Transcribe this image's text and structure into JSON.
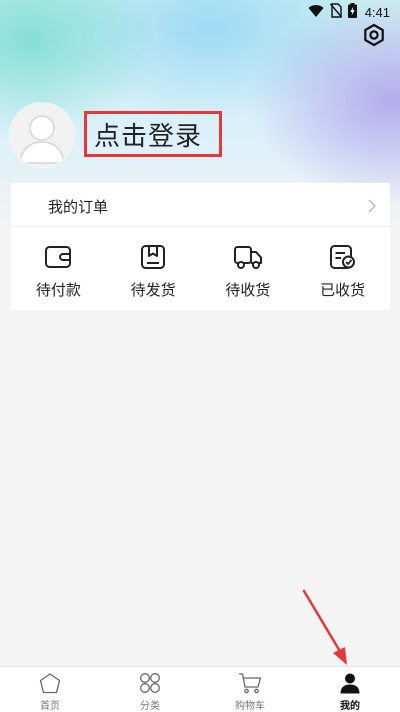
{
  "status_bar": {
    "time": "4:41",
    "icons": [
      "wifi-icon",
      "no-sim-icon",
      "battery-charging-icon"
    ]
  },
  "header": {
    "settings_icon": "settings-hex-icon",
    "avatar_icon": "default-avatar-icon",
    "login_label": "点击登录"
  },
  "orders": {
    "title": "我的订单",
    "items": [
      {
        "label": "待付款",
        "icon": "wallet-icon"
      },
      {
        "label": "待发货",
        "icon": "package-box-icon"
      },
      {
        "label": "待收货",
        "icon": "delivery-truck-icon"
      },
      {
        "label": "已收货",
        "icon": "received-check-icon"
      }
    ]
  },
  "bottom_nav": {
    "items": [
      {
        "label": "首页",
        "icon": "home-icon",
        "active": false
      },
      {
        "label": "分类",
        "icon": "category-grid-icon",
        "active": false
      },
      {
        "label": "购物车",
        "icon": "shopping-cart-icon",
        "active": false
      },
      {
        "label": "我的",
        "icon": "person-icon",
        "active": true
      }
    ]
  },
  "colors": {
    "highlight_red": "#e53935",
    "card_bg": "#ffffff",
    "page_bg": "#f4f4f4",
    "text_primary": "#222222",
    "nav_inactive": "#777777"
  }
}
